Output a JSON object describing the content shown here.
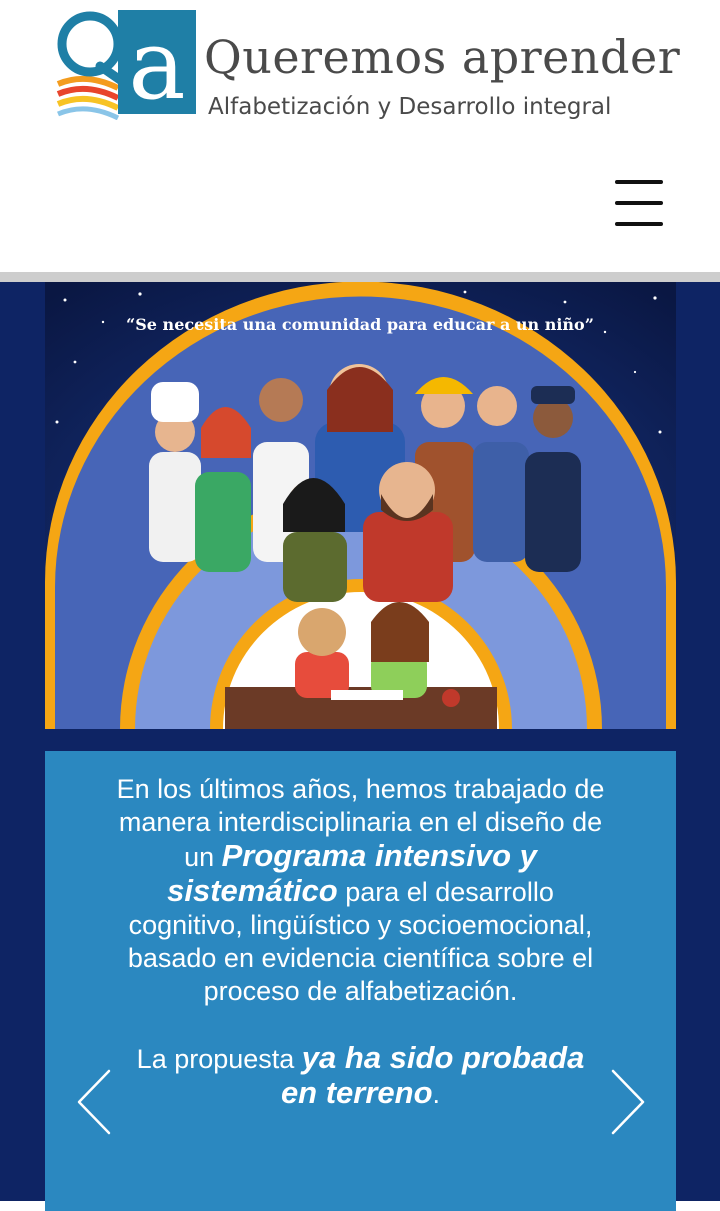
{
  "header": {
    "brand_name": "Queremos aprender",
    "brand_tagline": "Alfabetización y Desarrollo integral",
    "logo_mark": "Qa",
    "menu_icon": "hamburger-menu-icon"
  },
  "hero": {
    "quote": "“Se necesita una comunidad para educar a un niño”"
  },
  "card": {
    "p1_a": "En los últimos años, hemos trabajado de manera interdisciplinaria en el diseño de un ",
    "p1_em": "Programa intensivo y sistemático",
    "p1_b": " para el desarrollo cognitivo, lingüístico y socioemocional, basado en evidencia científica sobre el proceso de alfabetización.",
    "p2_a": "La propuesta ",
    "p2_em": "ya ha sido probada en terreno",
    "p2_b": "."
  },
  "slider": {
    "prev_icon": "chevron-left-icon",
    "next_icon": "chevron-right-icon"
  },
  "colors": {
    "page_background": "#0e2464",
    "card_background": "#2b88c0",
    "logo_teal": "#1f7fa6",
    "text_dark": "#4a4a4a"
  }
}
